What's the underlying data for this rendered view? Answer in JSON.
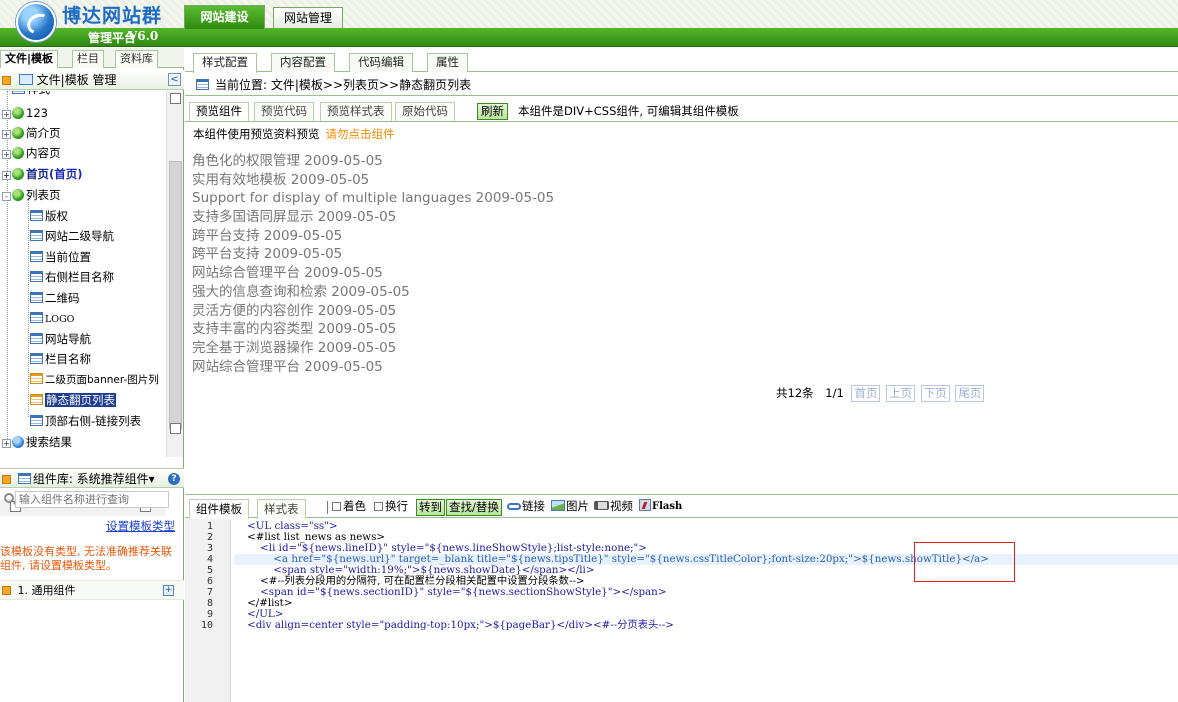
{
  "header": {
    "logo_title": "博达网站群",
    "logo_subtitle": "管理平台",
    "logo_version": "V6.0",
    "tabs": [
      {
        "label": "网站建设",
        "active": true
      },
      {
        "label": "网站管理",
        "active": false
      }
    ]
  },
  "left": {
    "tabs": [
      "文件|模板",
      "栏目",
      "资料库"
    ],
    "tree_header": "文件|模板 管理",
    "collapse_glyph": "<",
    "tree": [
      {
        "label": "样式",
        "level": 0
      },
      {
        "label": "123",
        "level": 0,
        "toggle": "+"
      },
      {
        "label": "简介页",
        "level": 0,
        "toggle": "+"
      },
      {
        "label": "内容页",
        "level": 0,
        "toggle": "+"
      },
      {
        "label": "首页",
        "suffix": "(首页)",
        "level": 0,
        "toggle": "+"
      },
      {
        "label": "列表页",
        "level": 0,
        "toggle": "-"
      },
      {
        "label": "版权",
        "level": 1
      },
      {
        "label": "网站二级导航",
        "level": 1
      },
      {
        "label": "当前位置",
        "level": 1
      },
      {
        "label": "右侧栏目名称",
        "level": 1
      },
      {
        "label": "二维码",
        "level": 1
      },
      {
        "label": "LOGO",
        "level": 1
      },
      {
        "label": "网站导航",
        "level": 1
      },
      {
        "label": "栏目名称",
        "level": 1
      },
      {
        "label": "二级页面banner-图片列",
        "level": 1
      },
      {
        "label": "静态翻页列表",
        "level": 1,
        "selected": true
      },
      {
        "label": "顶部右侧-链接列表",
        "level": 1
      },
      {
        "label": "搜索结果",
        "level": 0,
        "toggle": "+"
      }
    ],
    "component_header": "组件库: 系统推荐组件▾",
    "help_glyph": "?",
    "search_placeholder": "输入组件名称进行查询",
    "set_type_link": "设置模板类型",
    "warning": "该模板没有类型, 无法准确推荐关联组件, 请设置模板类型。",
    "general_component": "1. 通用组件",
    "general_add_glyph": "+"
  },
  "main": {
    "tabs": [
      "样式配置",
      "内容配置",
      "代码编辑",
      "属性"
    ],
    "location": "当前位置: 文件|模板>>列表页>>静态翻页列表",
    "preview_tabs": [
      "预览组件",
      "预览代码",
      "预览样式表",
      "原始代码"
    ],
    "refresh_label": "刷新",
    "preview_note": "本组件是DIV+CSS组件, 可编辑其组件模板",
    "preview_info": "本组件使用预览资料预览",
    "preview_warn": "请勿点击组件",
    "news": [
      "角色化的权限管理 2009-05-05",
      "实用有效地模板 2009-05-05",
      "Support for display of multiple languages 2009-05-05",
      "支持多国语同屏显示 2009-05-05",
      "跨平台支持 2009-05-05",
      "跨平台支持 2009-05-05",
      "网站综合管理平台 2009-05-05",
      "强大的信息查询和检索 2009-05-05",
      "灵活方便的内容创作 2009-05-05",
      "支持丰富的内容类型 2009-05-05",
      "完全基于浏览器操作 2009-05-05",
      "网站综合管理平台 2009-05-05"
    ],
    "pager": {
      "total": "共12条",
      "page": "1/1",
      "buttons": [
        "首页",
        "上页",
        "下页",
        "尾页"
      ]
    },
    "code_tabs": [
      "组件模板",
      "样式表"
    ],
    "toolbar": {
      "color_label": "着色",
      "wrap_label": "换行",
      "goto_label": "转到",
      "find_replace_label": "查找/替换",
      "link_label": "链接",
      "image_label": "图片",
      "video_label": "视频",
      "flash_label": "Flash"
    },
    "code_lines": [
      {
        "n": "1",
        "text": "    <UL class=\"ss\">"
      },
      {
        "n": "2",
        "text": "    <#list list_news as news>"
      },
      {
        "n": "3",
        "text": "        <li id=\"${news.lineID}\" style=\"${news.lineShowStyle};list-style:none;\">"
      },
      {
        "n": "4",
        "text": "            <a href=\"${news.url}\" target=_blank title=\"${news.tipsTitle}\" style=\"${news.cssTitleColor};font-size:20px;\">${news.showTitle}</a>"
      },
      {
        "n": "5",
        "text": "            <span style=\"width:19%;\">${news.showDate}</span></li>"
      },
      {
        "n": "6",
        "text": "        <#--列表分段用的分隔符, 可在配置栏分段相关配置中设置分段条数-->"
      },
      {
        "n": "7",
        "text": "        <span id=\"${news.sectionID}\" style=\"${news.sectionShowStyle}\"></span>"
      },
      {
        "n": "8",
        "text": "    </#list>"
      },
      {
        "n": "9",
        "text": "    </UL>"
      },
      {
        "n": "10",
        "text": "    <div align=center style=\"padding-top:10px;\">${pageBar}</div><#--分页表头-->"
      }
    ]
  }
}
